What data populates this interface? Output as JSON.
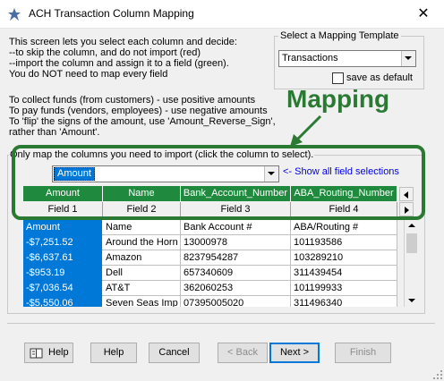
{
  "window": {
    "title": "ACH Transaction Column Mapping",
    "close_glyph": "✕"
  },
  "intro_lines": [
    "This screen lets you select each column and decide:",
    "--to skip the column, and do not import (red)",
    "--import the column and assign it to a field (green).",
    "You do NOT need to map every field"
  ],
  "funds_lines": [
    "To collect funds (from customers) - use positive amounts",
    "To pay funds (vendors, employees) - use negative amounts",
    "To 'flip' the signs of the amount, use 'Amount_Reverse_Sign',",
    "rather than 'Amount'."
  ],
  "template": {
    "legend": "Select a Mapping Template",
    "selected": "Transactions",
    "save_default_label": "save as default",
    "save_default_checked": false
  },
  "annotation": {
    "label": "Mapping",
    "color": "#2b7a34"
  },
  "mapping": {
    "legend": "Only map the columns you need to import (click the column to select).",
    "field_selected": "Amount",
    "show_all_link": "<- Show all field selections"
  },
  "grid": {
    "header": [
      "Amount",
      "Name",
      "Bank_Account_Number",
      "ABA_Routing_Number"
    ],
    "fields": [
      "Field 1",
      "Field 2",
      "Field 3",
      "Field 4"
    ],
    "rows": [
      [
        "Amount",
        "Name",
        "Bank Account #",
        "ABA/Routing #"
      ],
      [
        "-$7,251.52",
        "Around the Horn",
        "13000978",
        "101193586"
      ],
      [
        "-$6,637.61",
        "Amazon",
        "8237954287",
        "103289210"
      ],
      [
        "-$953.19",
        "Dell",
        "657340609",
        "311439454"
      ],
      [
        "-$7,036.54",
        "AT&T",
        "362060253",
        "101199933"
      ],
      [
        "-$5,550.06",
        "Seven Seas Imp",
        "07395005020",
        "311496340"
      ]
    ],
    "header_color": "#1f8a3e",
    "selected_color": "#0078d7"
  },
  "buttons": {
    "help_icon_label": "Help",
    "help": "Help",
    "cancel": "Cancel",
    "back": "< Back",
    "next": "Next >",
    "finish": "Finish"
  }
}
